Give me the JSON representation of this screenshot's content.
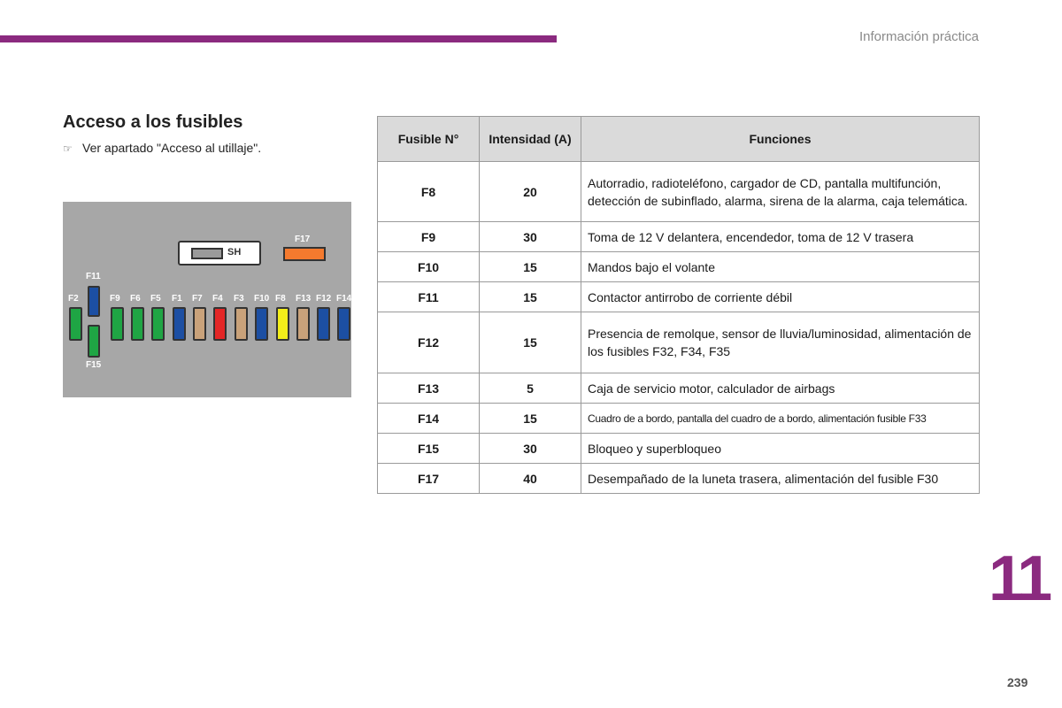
{
  "header": {
    "section": "Información práctica"
  },
  "title": "Acceso a los fusibles",
  "note": {
    "icon": "pointing-hand-icon",
    "text": "Ver apartado \"Acceso al utillaje\"."
  },
  "diagram": {
    "sh_label": "SH",
    "f17_label": "F17",
    "f11_label": "F11",
    "f15_label": "F15",
    "fuses": [
      {
        "label": "F2",
        "color": "#1fa544"
      },
      {
        "label": "F9",
        "color": "#1fa544"
      },
      {
        "label": "F6",
        "color": "#1fa544"
      },
      {
        "label": "F5",
        "color": "#1fa544"
      },
      {
        "label": "F1",
        "color": "#1c4fa3"
      },
      {
        "label": "F7",
        "color": "#c9a27a"
      },
      {
        "label": "F4",
        "color": "#e32626"
      },
      {
        "label": "F3",
        "color": "#c9a27a"
      },
      {
        "label": "F10",
        "color": "#1c4fa3"
      },
      {
        "label": "F8",
        "color": "#f3ee1a"
      },
      {
        "label": "F13",
        "color": "#c9a27a"
      },
      {
        "label": "F12",
        "color": "#1c4fa3"
      },
      {
        "label": "F14",
        "color": "#1c4fa3"
      }
    ],
    "f11_color": "#1c4fa3",
    "f15_color": "#1fa544",
    "f17_color": "#f47a2e"
  },
  "table": {
    "headers": {
      "fusible": "Fusible N°",
      "intensidad": "Intensidad (A)",
      "funciones": "Funciones"
    },
    "rows": [
      {
        "fuse": "F8",
        "amps": "20",
        "func": "Autorradio, radioteléfono, cargador de CD, pantalla multifunción, detección de subinflado, alarma, sirena de la alarma, caja telemática."
      },
      {
        "fuse": "F9",
        "amps": "30",
        "func": "Toma de 12 V delantera, encendedor, toma de 12 V trasera"
      },
      {
        "fuse": "F10",
        "amps": "15",
        "func": "Mandos bajo el volante"
      },
      {
        "fuse": "F11",
        "amps": "15",
        "func": "Contactor antirrobo de corriente débil"
      },
      {
        "fuse": "F12",
        "amps": "15",
        "func": "Presencia de remolque, sensor de lluvia/luminosidad, alimentación de los fusibles F32, F34, F35"
      },
      {
        "fuse": "F13",
        "amps": "5",
        "func": "Caja de servicio motor, calculador de airbags"
      },
      {
        "fuse": "F14",
        "amps": "15",
        "func": "Cuadro de a bordo, pantalla del cuadro de a bordo, alimentación fusible F33"
      },
      {
        "fuse": "F15",
        "amps": "30",
        "func": "Bloqueo y superbloqueo"
      },
      {
        "fuse": "F17",
        "amps": "40",
        "func": "Desempañado de la luneta trasera, alimentación del fusible F30"
      }
    ]
  },
  "chapter_number": "11",
  "page_number": "239",
  "colors": {
    "accent": "#8b2a7f",
    "header_bg": "#dadada",
    "diagram_bg": "#a7a7a7"
  }
}
